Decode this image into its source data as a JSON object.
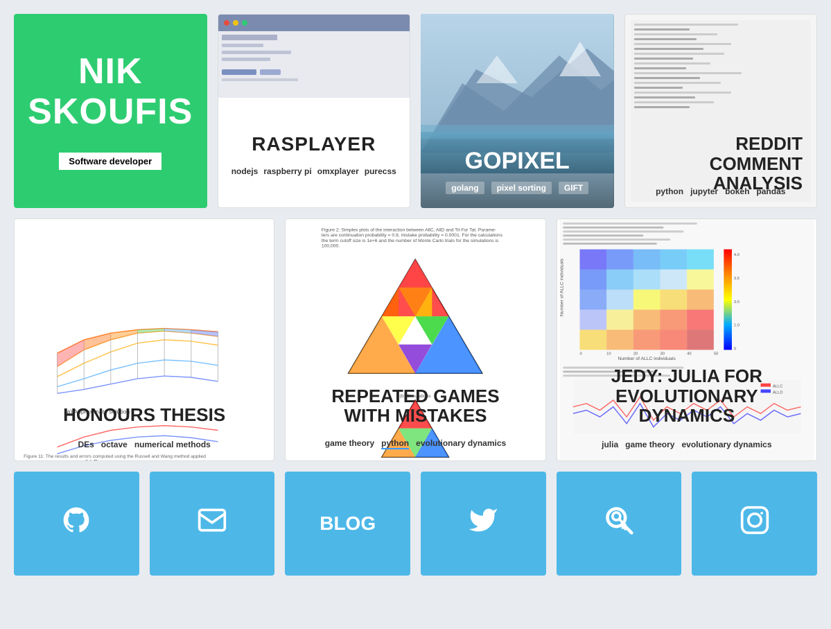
{
  "cards": {
    "nik": {
      "title_line1": "NIK",
      "title_line2": "SKOUFIS",
      "subtitle": "Software developer"
    },
    "rasplayer": {
      "title": "RASPLAYER",
      "tags": [
        "nodejs",
        "raspberry pi",
        "omxplayer",
        "purecss"
      ]
    },
    "gopixel": {
      "title": "GOPIXEL",
      "tags": [
        "golang",
        "pixel sorting",
        "GIFT"
      ]
    },
    "reddit": {
      "title_line1": "REDDIT",
      "title_line2": "COMMENT",
      "title_line3": "ANALYSIS",
      "tags": [
        "python",
        "jupyter",
        "bokeh",
        "pandas"
      ]
    },
    "thesis": {
      "title": "HONOURS THESIS",
      "tags": [
        "DEs",
        "octave",
        "numerical methods"
      ]
    },
    "games": {
      "title_line1": "REPEATED GAMES",
      "title_line2": "WITH MISTAKES",
      "tags": [
        "game theory",
        "python",
        "evolutionary dynamics"
      ]
    },
    "jedy": {
      "title_line1": "JEDY: JULIA FOR",
      "title_line2": "EVOLUTIONARY",
      "title_line3": "DYNAMICS",
      "tags": [
        "julia",
        "game theory",
        "evolutionary dynamics"
      ]
    }
  },
  "social": [
    {
      "id": "github",
      "icon": "github",
      "label": ""
    },
    {
      "id": "email",
      "icon": "email",
      "label": ""
    },
    {
      "id": "blog",
      "icon": "",
      "label": "BLOG"
    },
    {
      "id": "twitter",
      "icon": "twitter",
      "label": ""
    },
    {
      "id": "search",
      "icon": "search",
      "label": ""
    },
    {
      "id": "instagram",
      "icon": "instagram",
      "label": ""
    }
  ]
}
